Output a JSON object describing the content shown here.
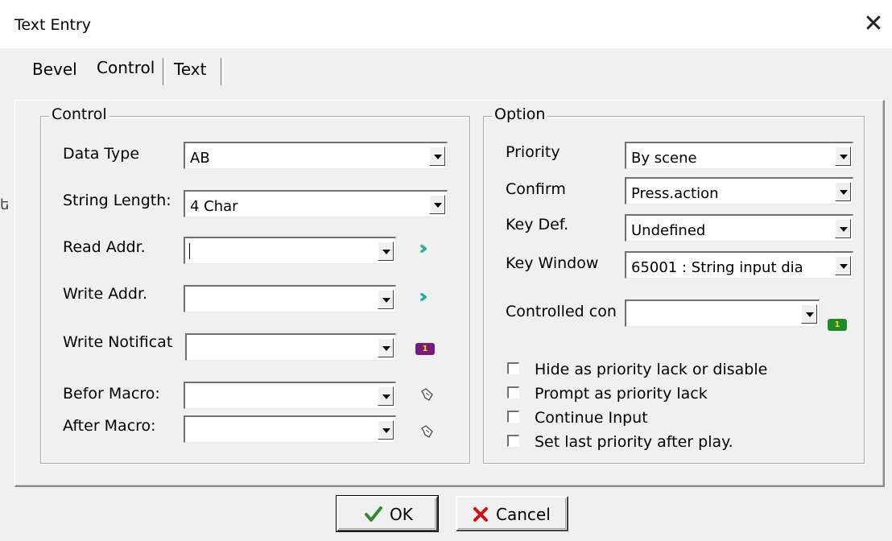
{
  "window": {
    "title": "Text Entry",
    "close_glyph": "✕"
  },
  "tabs": [
    {
      "label": "Bevel"
    },
    {
      "label": "Control"
    },
    {
      "label": "Text"
    }
  ],
  "control_group": {
    "title": "Control",
    "fields": {
      "data_type": {
        "label": "Data Type",
        "value": "AB"
      },
      "string_length": {
        "label": "String Length:",
        "value": "4 Char"
      },
      "read_addr": {
        "label": "Read Addr.",
        "value": ""
      },
      "write_addr": {
        "label": "Write Addr.",
        "value": ""
      },
      "write_notification": {
        "label": "Write Notificat",
        "value": ""
      },
      "before_macro": {
        "label": "Befor Macro:",
        "value": ""
      },
      "after_macro": {
        "label": "After Macro:",
        "value": ""
      }
    },
    "icons": {
      "read_addr": "double-chevron-right-icon",
      "write_addr": "double-chevron-right-icon",
      "write_notification": "notification-badge-icon",
      "before_macro": "macro-hand-icon",
      "after_macro": "macro-hand-icon"
    },
    "badge_text": "1"
  },
  "option_group": {
    "title": "Option",
    "fields": {
      "priority": {
        "label": "Priority",
        "value": "By scene"
      },
      "confirm": {
        "label": "Confirm",
        "value": "Press.action"
      },
      "key_def": {
        "label": "Key Def.",
        "value": "Undefined"
      },
      "key_window": {
        "label": "Key Window",
        "value": "65001 : String input dia"
      },
      "controlled_con": {
        "label": "Controlled con",
        "value": ""
      }
    },
    "badge_text": "1",
    "checkboxes": [
      {
        "label": "Hide as priority lack or disable",
        "checked": false
      },
      {
        "label": "Prompt as priority lack",
        "checked": false
      },
      {
        "label": "Continue Input",
        "checked": false
      },
      {
        "label": "Set last priority after play.",
        "checked": false
      }
    ]
  },
  "buttons": {
    "ok": "OK",
    "cancel": "Cancel"
  },
  "colors": {
    "dialog_bg": "#f0f0f0",
    "chevron": "#20b2a0",
    "badge_purple": "#7a1a7a",
    "badge_green": "#1e8a2a",
    "ok_check": "#2e8b2e",
    "cancel_x": "#cc1111"
  }
}
